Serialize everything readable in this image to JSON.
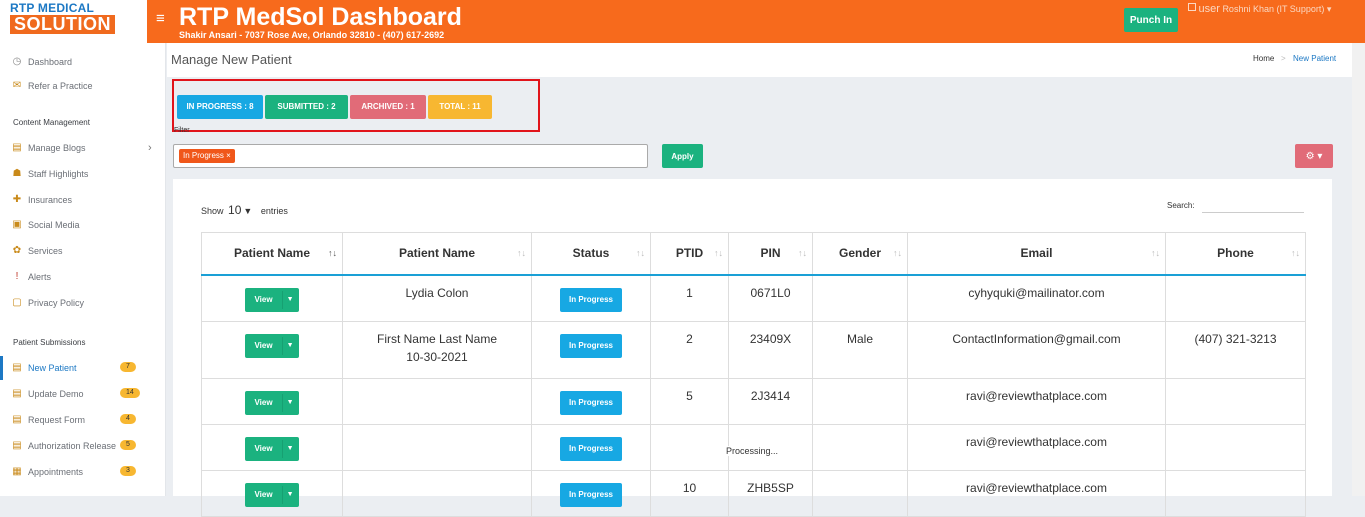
{
  "brand": {
    "line1": "RTP MEDICAL",
    "line2": "SOLUTION"
  },
  "header": {
    "title": "RTP MedSol Dashboard",
    "subtitle": "Shakir Ansari - 7037 Rose Ave, Orlando 32810 - (407) 617-2692",
    "punch_label": "Punch In",
    "user_alt": "user",
    "user_name": "Roshni Khan (IT Support)",
    "user_caret": "▾"
  },
  "sidebar": {
    "items": [
      {
        "label": "Dashboard",
        "icon": "dashboard-icon"
      },
      {
        "label": "Refer a Practice",
        "icon": "refer-icon"
      }
    ],
    "content_heading": "Content Management",
    "content_items": [
      {
        "label": "Manage Blogs",
        "icon": "blog-icon"
      },
      {
        "label": "Staff Highlights",
        "icon": "staff-icon"
      },
      {
        "label": "Insurances",
        "icon": "insurance-icon"
      },
      {
        "label": "Social Media",
        "icon": "social-icon"
      },
      {
        "label": "Services",
        "icon": "services-icon"
      },
      {
        "label": "Alerts",
        "icon": "alert-icon"
      },
      {
        "label": "Privacy Policy",
        "icon": "privacy-icon"
      }
    ],
    "patient_heading": "Patient Submissions",
    "patient_items": [
      {
        "label": "New Patient",
        "badge": "7",
        "active": true
      },
      {
        "label": "Update Demo",
        "badge": "14"
      },
      {
        "label": "Request Form",
        "badge": "4"
      },
      {
        "label": "Authorization Release",
        "badge": "5"
      },
      {
        "label": "Appointments",
        "badge": "3"
      }
    ]
  },
  "page": {
    "title": "Manage New Patient",
    "crumb_home": "Home",
    "crumb_sep": ">",
    "crumb_current": "New Patient"
  },
  "chips": [
    {
      "label": "IN PROGRESS : 8",
      "color": "#17a8e3"
    },
    {
      "label": "SUBMITTED : 2",
      "color": "#1bb27f"
    },
    {
      "label": "ARCHIVED : 1",
      "color": "#e16b78"
    },
    {
      "label": "TOTAL : 11",
      "color": "#f7b731"
    }
  ],
  "filter": {
    "label": "Filter",
    "tag": "In Progress ×",
    "apply_label": "Apply",
    "gear_label": "⚙ ▾"
  },
  "table": {
    "show_label": "Show",
    "show_value": "10",
    "entries_label": "entries",
    "search_label": "Search:",
    "headers": [
      "Patient Name",
      "Patient Name",
      "Status",
      "PTID",
      "PIN",
      "Gender",
      "Email",
      "Phone"
    ],
    "view_label": "View",
    "rows": [
      {
        "name": "Lydia Colon",
        "name2": "",
        "status": "In Progress",
        "ptid": "1",
        "pin": "0671L0",
        "gender": "",
        "email": "cyhyquki@mailinator.com",
        "phone": ""
      },
      {
        "name": "First Name Last Name",
        "name2": "10-30-2021",
        "status": "In Progress",
        "ptid": "2",
        "pin": "23409X",
        "gender": "Male",
        "email": "ContactInformation@gmail.com",
        "phone": "(407) 321-3213"
      },
      {
        "name": "",
        "name2": "",
        "status": "In Progress",
        "ptid": "5",
        "pin": "2J3414",
        "gender": "",
        "email": "ravi@reviewthatplace.com",
        "phone": ""
      },
      {
        "name": "",
        "name2": "",
        "status": "In Progress",
        "ptid": "",
        "pin": "",
        "gender": "",
        "email": "ravi@reviewthatplace.com",
        "phone": ""
      },
      {
        "name": "",
        "name2": "",
        "status": "In Progress",
        "ptid": "10",
        "pin": "ZHB5SP",
        "gender": "",
        "email": "ravi@reviewthatplace.com",
        "phone": ""
      }
    ],
    "processing": "Processing..."
  }
}
